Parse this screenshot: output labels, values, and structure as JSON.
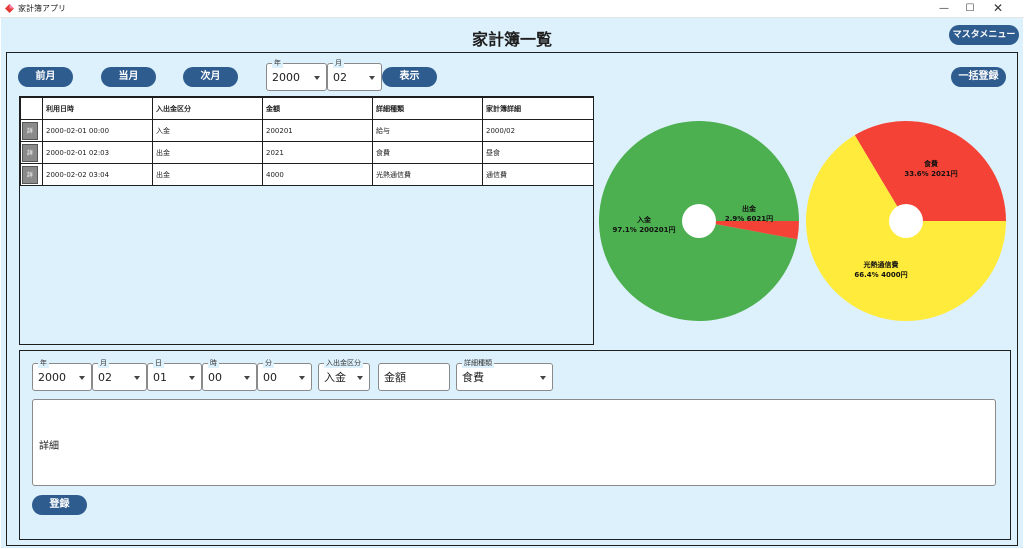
{
  "window": {
    "title": "家計簿アプリ",
    "minimize": "—",
    "maximize": "☐",
    "close": "✕"
  },
  "page": {
    "title": "家計簿一覧",
    "master_menu": "マスタメニュー"
  },
  "nav": {
    "prev": "前月",
    "current": "当月",
    "next": "次月",
    "show": "表示",
    "bulk": "一括登録",
    "year_label": "年",
    "year_value": "2000",
    "month_label": "月",
    "month_value": "02"
  },
  "table": {
    "headers": [
      "",
      "利用日時",
      "入出金区分",
      "金額",
      "詳細種類",
      "家計簿詳細"
    ],
    "detail_button": "詳",
    "rows": [
      [
        "2000-02-01 00:00",
        "入金",
        "200201",
        "給与",
        "2000/02"
      ],
      [
        "2000-02-01 02:03",
        "出金",
        "2021",
        "食費",
        "昼食"
      ],
      [
        "2000-02-02 03:04",
        "出金",
        "4000",
        "光熱通信費",
        "通信費"
      ]
    ]
  },
  "chart_data": [
    {
      "type": "pie",
      "labels": [
        "入金",
        "出金"
      ],
      "values": [
        200201,
        6021
      ],
      "label_lines": [
        "97.1% 200201円",
        "2.9% 6021円"
      ],
      "colors": [
        "#4caf50",
        "#f44336"
      ],
      "donut_hole": true
    },
    {
      "type": "pie",
      "labels": [
        "食費",
        "光熱通信費"
      ],
      "values": [
        2021,
        4000
      ],
      "label_lines": [
        "33.6% 2021円",
        "66.4% 4000円"
      ],
      "colors": [
        "#f44336",
        "#ffeb3b"
      ],
      "donut_hole": true
    }
  ],
  "form": {
    "year_label": "年",
    "year_value": "2000",
    "month_label": "月",
    "month_value": "02",
    "day_label": "日",
    "day_value": "01",
    "hour_label": "時",
    "hour_value": "00",
    "minute_label": "分",
    "minute_value": "00",
    "type_label": "入出金区分",
    "type_value": "入金",
    "amount_placeholder": "金額",
    "category_label": "詳細種類",
    "category_value": "食費",
    "detail_placeholder": "詳細",
    "register": "登録"
  }
}
